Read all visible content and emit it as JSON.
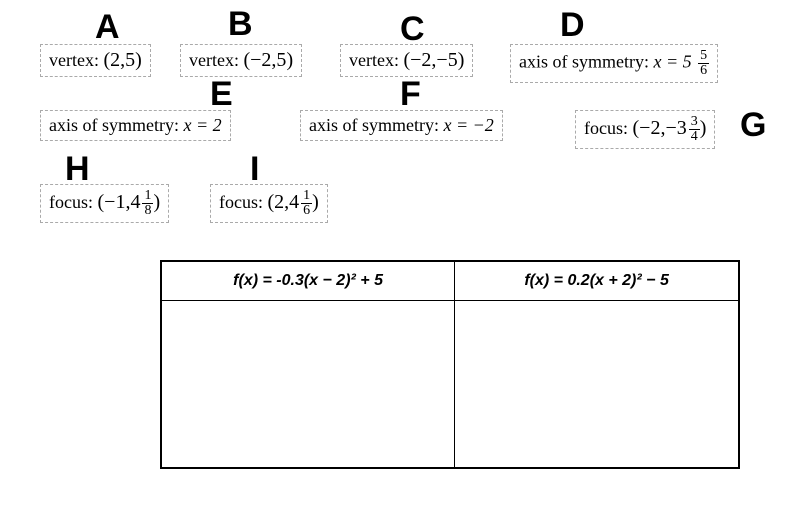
{
  "labels": {
    "A": "A",
    "B": "B",
    "C": "C",
    "D": "D",
    "E": "E",
    "F": "F",
    "G": "G",
    "H": "H",
    "I": "I"
  },
  "tiles": {
    "A": {
      "label": "vertex:",
      "value_open": "(",
      "x": "2,5",
      "value_close": ")"
    },
    "B": {
      "label": "vertex:",
      "value_open": "(",
      "x": "−2,5",
      "value_close": ")"
    },
    "C": {
      "label": "vertex:",
      "value_open": "(",
      "x": "−2,−5",
      "value_close": ")"
    },
    "D": {
      "label": "axis of symmetry:",
      "equation": "x  =  5",
      "frac_num": "5",
      "frac_den": "6"
    },
    "E": {
      "label": "axis of symmetry:",
      "equation": "x  =  2"
    },
    "F": {
      "label": "axis of symmetry:",
      "equation": "x  =  −2"
    },
    "G": {
      "label": "focus:",
      "value_open": "(",
      "x": "−2,",
      "y_int": "−3",
      "frac_num": "3",
      "frac_den": "4",
      "value_close": ")"
    },
    "H": {
      "label": "focus:",
      "value_open": "(",
      "x": "−1,",
      "y_int": "4",
      "frac_num": "1",
      "frac_den": "8",
      "value_close": ")"
    },
    "I": {
      "label": "focus:",
      "value_open": "(",
      "x": "2,",
      "y_int": "4",
      "frac_num": "1",
      "frac_den": "6",
      "value_close": ")"
    }
  },
  "table_headers": {
    "eq1": "f(x) = -0.3(x − 2)² + 5",
    "eq2": "f(x) = 0.2(x + 2)² − 5"
  }
}
